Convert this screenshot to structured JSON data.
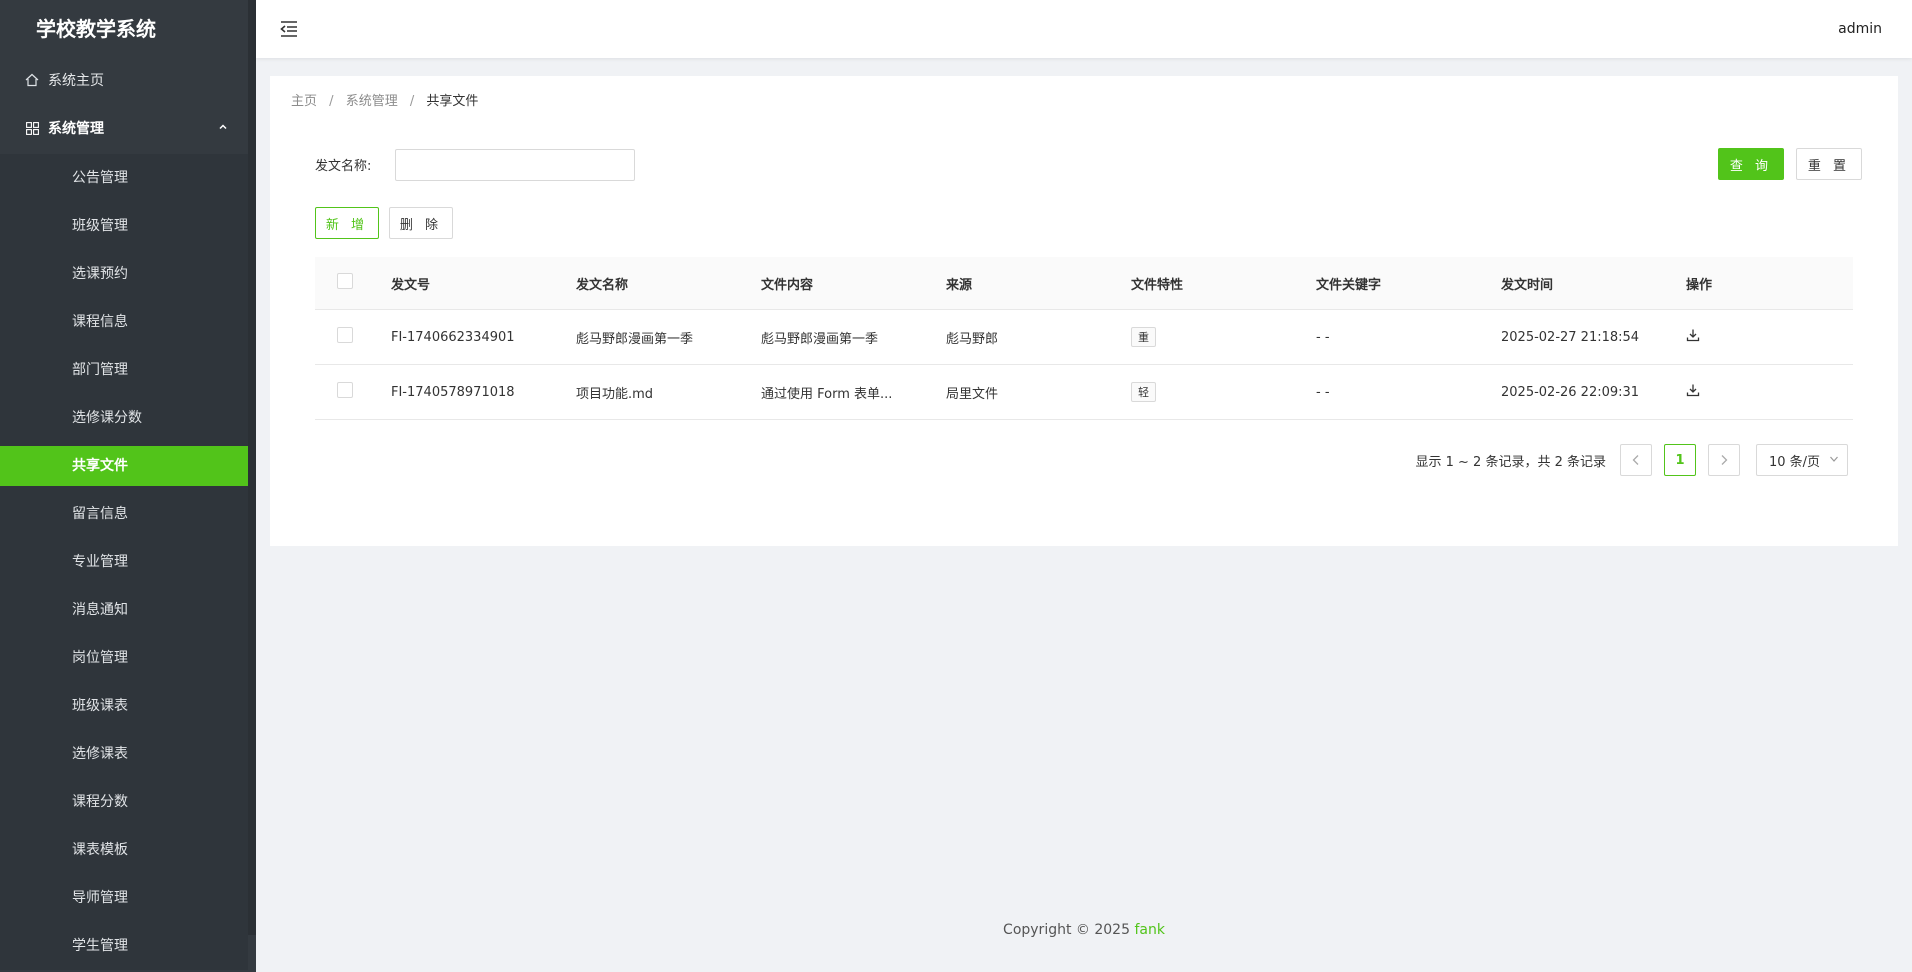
{
  "app": {
    "title": "学校教学系统",
    "user": "admin"
  },
  "sidebar": {
    "home_label": "系统主页",
    "group_label": "系统管理",
    "items": [
      {
        "label": "公告管理"
      },
      {
        "label": "班级管理"
      },
      {
        "label": "选课预约"
      },
      {
        "label": "课程信息"
      },
      {
        "label": "部门管理"
      },
      {
        "label": "选修课分数"
      },
      {
        "label": "共享文件",
        "active": true
      },
      {
        "label": "留言信息"
      },
      {
        "label": "专业管理"
      },
      {
        "label": "消息通知"
      },
      {
        "label": "岗位管理"
      },
      {
        "label": "班级课表"
      },
      {
        "label": "选修课表"
      },
      {
        "label": "课程分数"
      },
      {
        "label": "课表模板"
      },
      {
        "label": "导师管理"
      },
      {
        "label": "学生管理"
      }
    ]
  },
  "breadcrumb": {
    "items": [
      "主页",
      "系统管理",
      "共享文件"
    ],
    "separator": "/"
  },
  "filter": {
    "label": "发文名称:",
    "value": "",
    "placeholder": "",
    "query_label": "查 询",
    "reset_label": "重 置"
  },
  "actions": {
    "add_label": "新 增",
    "delete_label": "删 除"
  },
  "table": {
    "columns": [
      "发文号",
      "发文名称",
      "文件内容",
      "来源",
      "文件特性",
      "文件关键字",
      "发文时间",
      "操作"
    ],
    "rows": [
      {
        "doc_no": "FI-1740662334901",
        "name": "彪马野郎漫画第一季",
        "content": "彪马野郎漫画第一季",
        "source": "彪马野郎",
        "feature": "重",
        "keyword": "- -",
        "time": "2025-02-27 21:18:54"
      },
      {
        "doc_no": "FI-1740578971018",
        "name": "项目功能.md",
        "content": "通过使用 Form 表单...",
        "source": "局里文件",
        "feature": "轻",
        "keyword": "- -",
        "time": "2025-02-26 22:09:31"
      }
    ]
  },
  "pagination": {
    "summary": "显示 1 ~ 2 条记录，共 2 条记录",
    "current_page": "1",
    "page_size": "10 条/页"
  },
  "footer": {
    "copyright": "Copyright © 2025",
    "author": "fank"
  },
  "colors": {
    "accent": "#52c41a",
    "sidebar_bg": "#343a40",
    "content_bg": "#f0f2f5"
  }
}
